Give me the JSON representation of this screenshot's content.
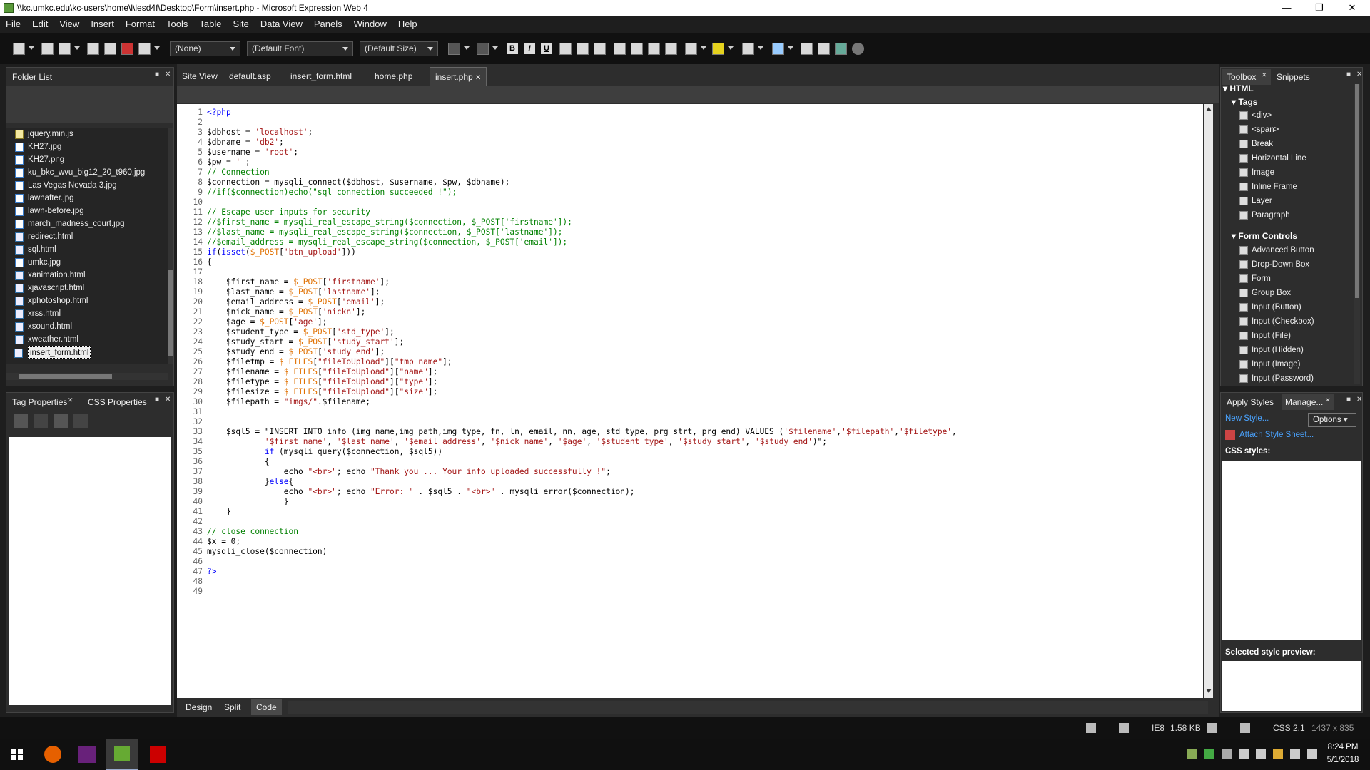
{
  "window": {
    "title": "\\\\kc.umkc.edu\\kc-users\\home\\l\\lesd4f\\Desktop\\Form\\insert.php - Microsoft Expression Web 4"
  },
  "menu": [
    "File",
    "Edit",
    "View",
    "Insert",
    "Format",
    "Tools",
    "Table",
    "Site",
    "Data View",
    "Panels",
    "Window",
    "Help"
  ],
  "toolbar": {
    "style_select": "(None)",
    "font_select": "(Default Font)",
    "size_select": "(Default Size)",
    "bold": "B",
    "italic": "I",
    "underline": "U"
  },
  "folder_list": {
    "title": "Folder List",
    "files": [
      "jquery.min.js",
      "KH27.jpg",
      "KH27.png",
      "ku_bkc_wvu_big12_20_t960.jpg",
      "Las Vegas Nevada 3.jpg",
      "lawnafter.jpg",
      "lawn-before.jpg",
      "march_madness_court.jpg",
      "redirect.html",
      "sql.html",
      "umkc.jpg",
      "xanimation.html",
      "xjavascript.html",
      "xphotoshop.html",
      "xrss.html",
      "xsound.html",
      "xweather.html",
      "insert_form.html"
    ],
    "selected": "insert_form.html"
  },
  "props_panel": {
    "tab1": "Tag Properties",
    "tab2": "CSS Properties"
  },
  "editor_tabs": [
    "Site View",
    "default.asp",
    "insert_form.html",
    "home.php",
    "insert.php"
  ],
  "active_tab": "insert.php",
  "view_tabs": [
    "Design",
    "Split",
    "Code"
  ],
  "active_view": "Code",
  "code_lines": [
    "<?php",
    "",
    "$dbhost = 'localhost';",
    "$dbname = 'db2';",
    "$username = 'root';",
    "$pw = '';",
    "// Connection",
    "$connection = mysqli_connect($dbhost, $username, $pw, $dbname);",
    "//if($connection)echo(\"sql connection succeeded !\");",
    "",
    "// Escape user inputs for security",
    "//$first_name = mysqli_real_escape_string($connection, $_POST['firstname']);",
    "//$last_name = mysqli_real_escape_string($connection, $_POST['lastname']);",
    "//$email_address = mysqli_real_escape_string($connection, $_POST['email']);",
    "if(isset($_POST['btn_upload']))",
    "{",
    "",
    "    $first_name = $_POST['firstname'];",
    "    $last_name = $_POST['lastname'];",
    "    $email_address = $_POST['email'];",
    "    $nick_name = $_POST['nickn'];",
    "    $age = $_POST['age'];",
    "    $student_type = $_POST['std_type'];",
    "    $study_start = $_POST['study_start'];",
    "    $study_end = $_POST['study_end'];",
    "    $filetmp = $_FILES[\"fileToUpload\"][\"tmp_name\"];",
    "    $filename = $_FILES[\"fileToUpload\"][\"name\"];",
    "    $filetype = $_FILES[\"fileToUpload\"][\"type\"];",
    "    $filesize = $_FILES[\"fileToUpload\"][\"size\"];",
    "    $filepath = \"imgs/\".$filename;",
    "",
    "",
    "    $sql5 = \"INSERT INTO info (img_name,img_path,img_type, fn, ln, email, nn, age, std_type, prg_strt, prg_end) VALUES ('$filename','$filepath','$filetype',",
    "            '$first_name', '$last_name', '$email_address', '$nick_name', '$age', '$student_type', '$study_start', '$study_end')\";",
    "            if (mysqli_query($connection, $sql5))",
    "            {",
    "                echo \"<br>\"; echo \"Thank you ... Your info uploaded successfully !\";",
    "            }else{",
    "                echo \"<br>\"; echo \"Error: \" . $sql5 . \"<br>\" . mysqli_error($connection);",
    "                }",
    "    }",
    "",
    "// close connection",
    "$x = 0;",
    "mysqli_close($connection)",
    "",
    "?>",
    "",
    ""
  ],
  "toolbox": {
    "tab1": "Toolbox",
    "tab2": "Snippets",
    "html": "HTML",
    "tags_header": "Tags",
    "tags": [
      "<div>",
      "<span>",
      "Break",
      "Horizontal Line",
      "Image",
      "Inline Frame",
      "Layer",
      "Paragraph"
    ],
    "form_header": "Form Controls",
    "form_controls": [
      "Advanced Button",
      "Drop-Down Box",
      "Form",
      "Group Box",
      "Input (Button)",
      "Input (Checkbox)",
      "Input (File)",
      "Input (Hidden)",
      "Input (Image)",
      "Input (Password)"
    ]
  },
  "styles": {
    "tab1": "Apply Styles",
    "tab2": "Manage...",
    "new_style": "New Style...",
    "options": "Options",
    "attach": "Attach Style Sheet...",
    "css_label": "CSS styles:",
    "preview_label": "Selected style preview:"
  },
  "statusbar": {
    "browser": "IE8",
    "size": "1.58 KB",
    "css": "CSS 2.1",
    "dims": "1437 x 835"
  },
  "taskbar": {
    "time": "8:24 PM",
    "date": "5/1/2018"
  }
}
